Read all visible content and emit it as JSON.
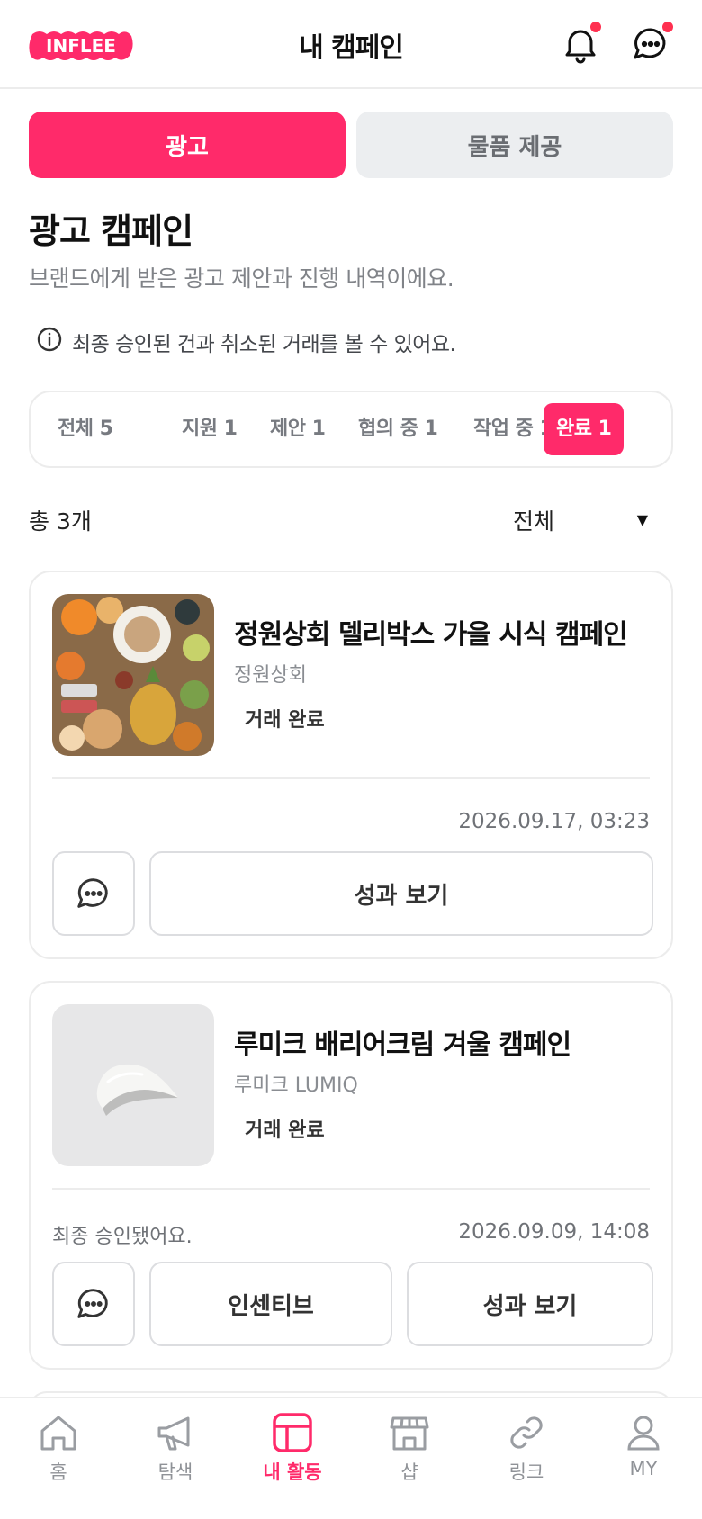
{
  "header": {
    "logo_text": "INFLEE",
    "title": "내 캠페인",
    "bell_icon": "bell-icon",
    "chat_icon": "chat-icon",
    "colors": {
      "accent": "#ff2a6a",
      "dot": "#ff3050"
    }
  },
  "segments": [
    {
      "label": "광고",
      "active": true
    },
    {
      "label": "물품 제공",
      "active": false
    }
  ],
  "section": {
    "title": "광고 캠페인",
    "description": "브랜드에게 받은 광고 제안과 진행 내역이에요.",
    "info_icon": "info-icon",
    "info": "최종 승인된 건과 취소된 거래를 볼 수 있어요."
  },
  "filters": [
    {
      "label": "전체 5",
      "active": false
    },
    {
      "label": "지원 1",
      "active": false
    },
    {
      "label": "제안 1",
      "active": false
    },
    {
      "label": "협의 중 1",
      "active": false
    },
    {
      "label": "작업 중 1",
      "active": false
    },
    {
      "label": "완료 1",
      "active": true
    }
  ],
  "list": {
    "total": "총 3개",
    "sort_value": "전체",
    "sort_arrow": "▼"
  },
  "cards": [
    {
      "title": "정원상회 델리박스 가을 시식 캠페인",
      "brand": "정원상회",
      "status": "거래 완료",
      "note": "",
      "date": "2026.09.17, 03:23",
      "buttons": [
        "성과 보기"
      ]
    },
    {
      "title": "루미크 배리어크림 겨울 캠페인",
      "brand": "루미크 LUMIQ",
      "status": "거래 완료",
      "note": "최종 승인됐어요.",
      "date": "2026.09.09, 14:08",
      "buttons": [
        "인센티브",
        "성과 보기"
      ]
    }
  ],
  "bottom_nav": [
    {
      "label": "홈",
      "icon": "home-icon",
      "active": false
    },
    {
      "label": "탐색",
      "icon": "megaphone-icon",
      "active": false
    },
    {
      "label": "내 활동",
      "icon": "activity-icon",
      "active": true
    },
    {
      "label": "샵",
      "icon": "shop-icon",
      "active": false
    },
    {
      "label": "링크",
      "icon": "link-icon",
      "active": false
    },
    {
      "label": "MY",
      "icon": "user-icon",
      "active": false
    }
  ]
}
